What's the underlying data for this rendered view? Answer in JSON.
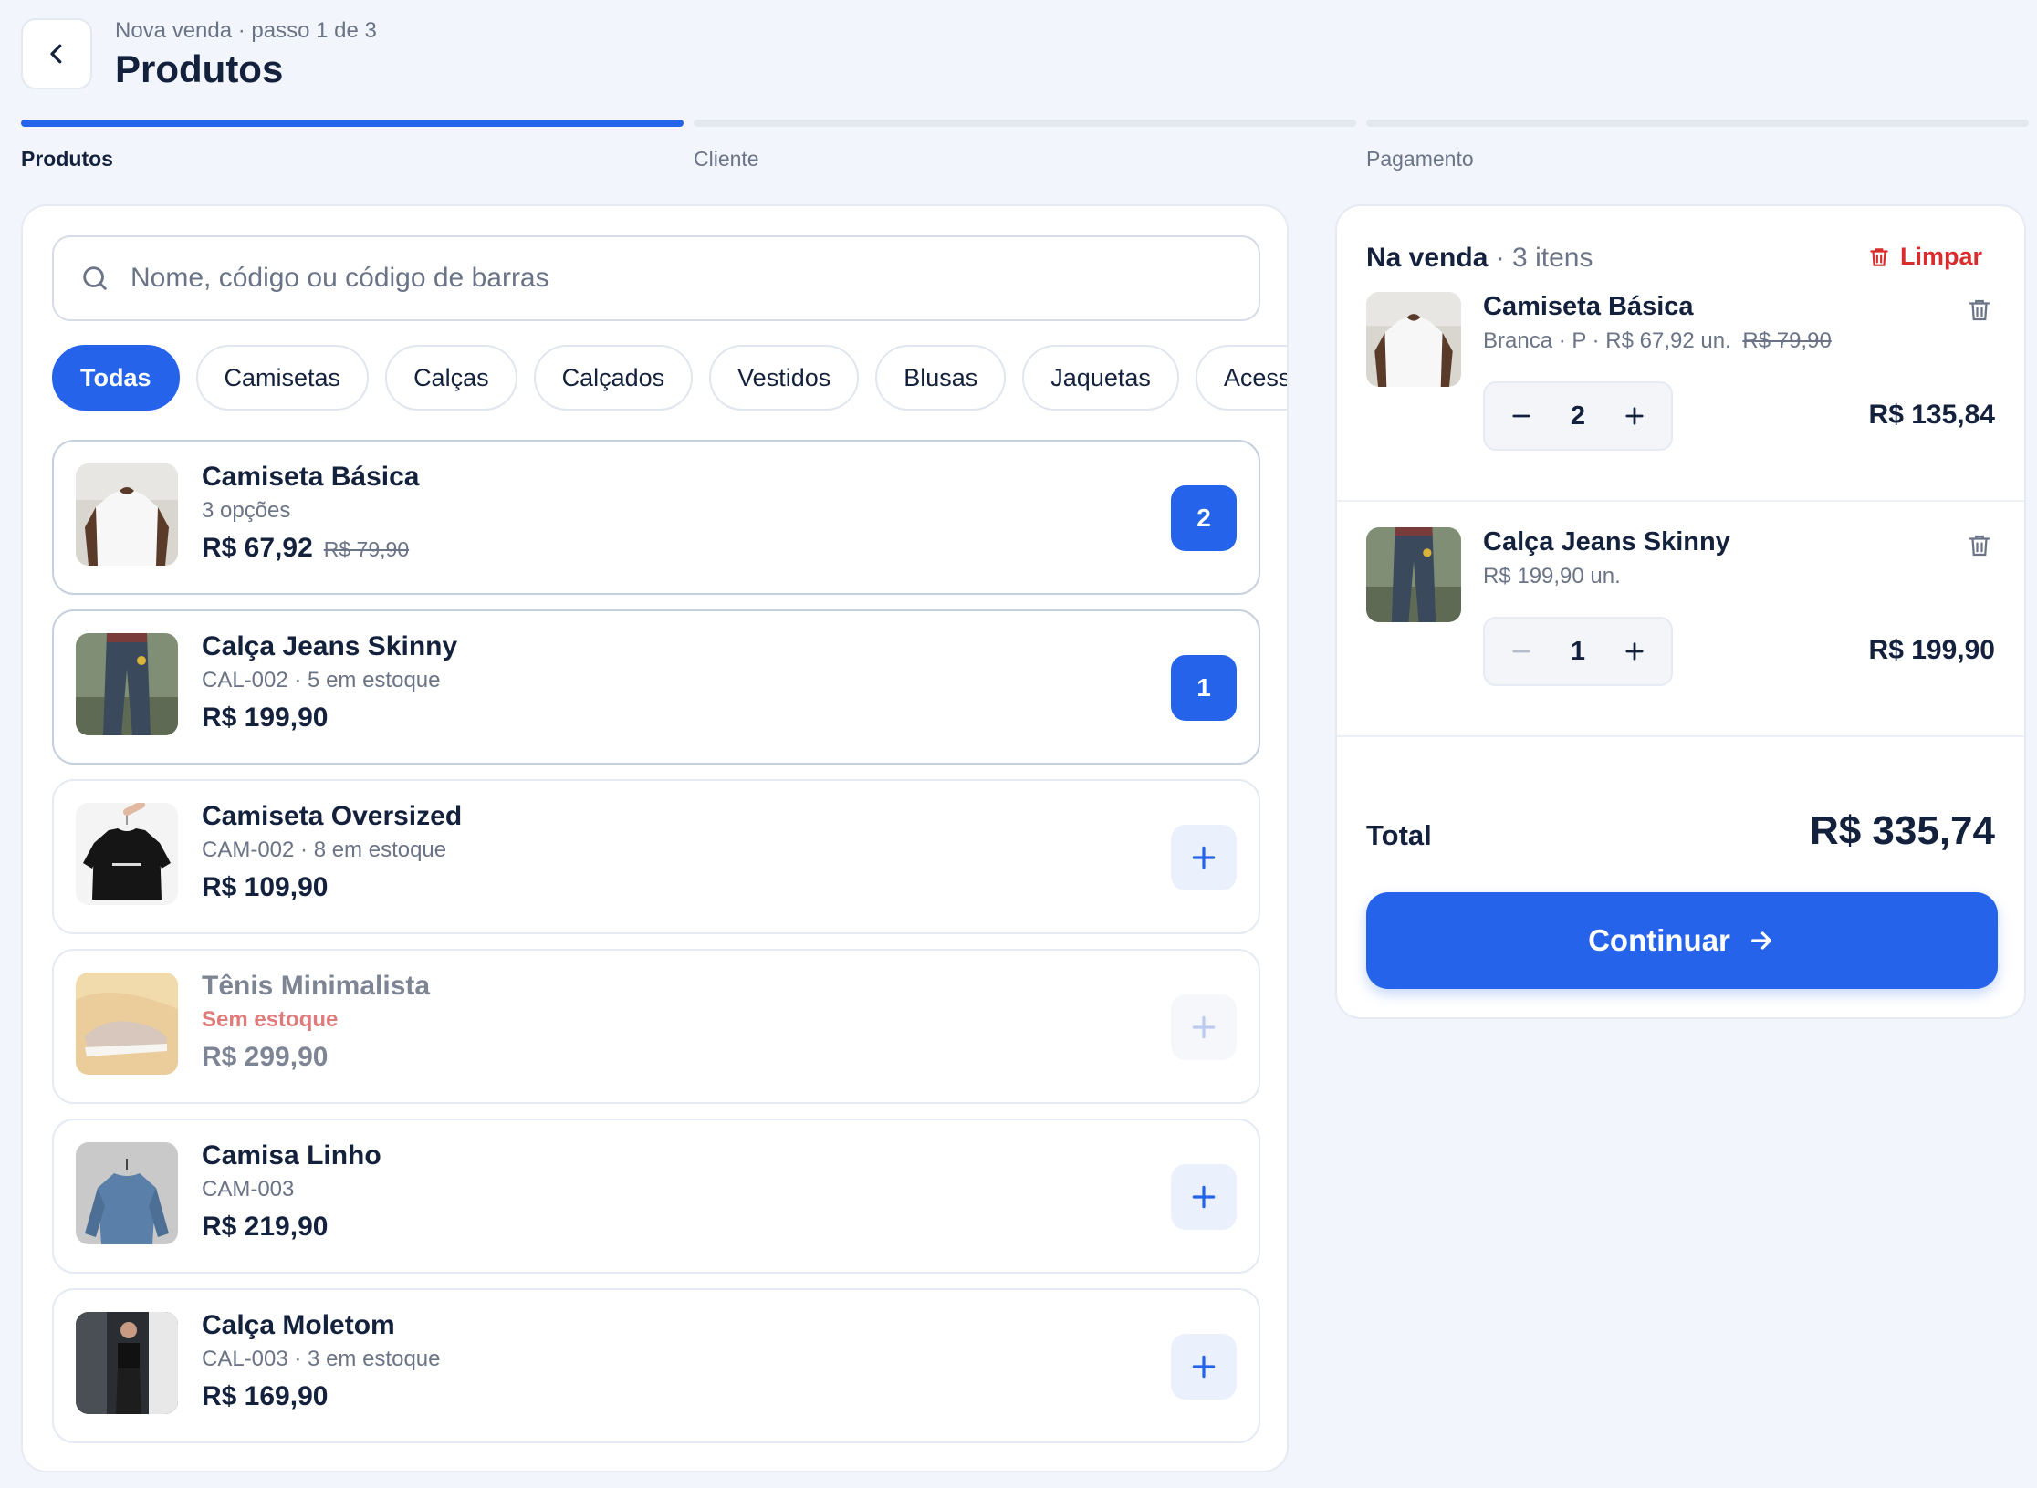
{
  "header": {
    "subtitle": "Nova venda · passo 1 de 3",
    "title": "Produtos"
  },
  "steps": [
    {
      "label": "Produtos",
      "active": true
    },
    {
      "label": "Cliente",
      "active": false
    },
    {
      "label": "Pagamento",
      "active": false
    }
  ],
  "search": {
    "placeholder": "Nome, código ou código de barras",
    "value": ""
  },
  "categories": [
    "Todas",
    "Camisetas",
    "Calças",
    "Calçados",
    "Vestidos",
    "Blusas",
    "Jaquetas",
    "Acessórios"
  ],
  "selected_category": "Todas",
  "products": [
    {
      "name": "Camiseta Básica",
      "meta": "3 opções",
      "price": "R$ 67,92",
      "old_price": "R$ 79,90",
      "qty": "2",
      "image_icon": "white-tshirt"
    },
    {
      "name": "Calça Jeans Skinny",
      "meta": "CAL-002 · 5 em estoque",
      "price": "R$ 199,90",
      "old_price": "",
      "qty": "1",
      "image_icon": "jeans"
    },
    {
      "name": "Camiseta Oversized",
      "meta": "CAM-002 · 8 em estoque",
      "price": "R$ 109,90",
      "old_price": "",
      "qty": "",
      "image_icon": "black-tshirt"
    },
    {
      "name": "Tênis Minimalista",
      "meta": "Sem estoque",
      "price": "R$ 299,90",
      "old_price": "",
      "qty": "",
      "image_icon": "sneaker"
    },
    {
      "name": "Camisa Linho",
      "meta": "CAM-003",
      "price": "R$ 219,90",
      "old_price": "",
      "qty": "",
      "image_icon": "denim-shirt"
    },
    {
      "name": "Calça Moletom",
      "meta": "CAL-003 · 3 em estoque",
      "price": "R$ 169,90",
      "old_price": "",
      "qty": "",
      "image_icon": "sweatpants"
    }
  ],
  "cart": {
    "title": "Na venda",
    "count": "· 3 itens",
    "clear_label": "Limpar",
    "items": [
      {
        "name": "Camiseta Básica",
        "meta": "Branca · P · R$ 67,92 un.",
        "old_price": "R$ 79,90",
        "qty": "2",
        "total": "R$ 135,84"
      },
      {
        "name": "Calça Jeans Skinny",
        "meta": "R$ 199,90 un.",
        "old_price": "",
        "qty": "1",
        "total": "R$ 199,90"
      }
    ],
    "total_label": "Total",
    "total_value": "R$ 335,74",
    "continue_label": "Continuar"
  },
  "colors": {
    "accent": "#2563eb",
    "danger": "#d92d2d",
    "text": "#14213d",
    "muted": "#6b7487",
    "out_of_stock": "#e07b7b"
  }
}
